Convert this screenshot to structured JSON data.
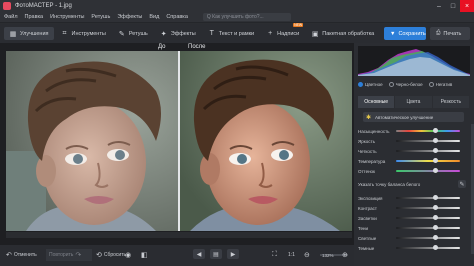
{
  "window": {
    "title": "ФотоМАСТЕР - 1.jpg"
  },
  "menu": {
    "items": [
      "Файл",
      "Правка",
      "Инструменты",
      "Ретушь",
      "Эффекты",
      "Вид",
      "Справка"
    ],
    "search_placeholder": "Q  Как улучшить фото?..."
  },
  "toolbar": {
    "tools": [
      {
        "label": "Улучшения",
        "icon": "enhance-icon",
        "glyph": "▦"
      },
      {
        "label": "Инструменты",
        "icon": "tools-icon",
        "glyph": "⌗"
      },
      {
        "label": "Ретушь",
        "icon": "retouch-icon",
        "glyph": "✎"
      },
      {
        "label": "Эффекты",
        "icon": "effects-icon",
        "glyph": "✦"
      },
      {
        "label": "Текст и рамки",
        "icon": "text-icon",
        "glyph": "T"
      },
      {
        "label": "Надписи",
        "icon": "captions-icon",
        "glyph": "+",
        "badge": "NEW"
      },
      {
        "label": "Пакетная обработка",
        "icon": "batch-icon",
        "glyph": "▣"
      }
    ],
    "save_label": "Сохранить",
    "print_label": "Печать"
  },
  "canvas": {
    "before_label": "До",
    "after_label": "После"
  },
  "panel": {
    "mode_options": [
      "Цветное",
      "Черно-белое",
      "Негатив"
    ],
    "mode_selected": "Цветное",
    "tabs": [
      "Основные",
      "Цвета",
      "Резкость"
    ],
    "auto_label": "Автоматическое улучшение",
    "sliders_top": [
      {
        "label": "Насыщенность",
        "value": 0.62,
        "gradient": "sat"
      },
      {
        "label": "Яркость",
        "value": 0.62,
        "gradient": "gray"
      },
      {
        "label": "Четкость",
        "value": 0.62,
        "gradient": "gray"
      },
      {
        "label": "Температура",
        "value": 0.62,
        "gradient": "temp"
      },
      {
        "label": "Оттенок",
        "value": 0.62,
        "gradient": "tint"
      }
    ],
    "wb_label": "Указать точку баланса белого",
    "sliders_bottom": [
      {
        "label": "Экспозиция",
        "value": 0.62,
        "gradient": "gray"
      },
      {
        "label": "Контраст",
        "value": 0.62,
        "gradient": "gray"
      },
      {
        "label": "Засветки",
        "value": 0.62,
        "gradient": "gray"
      },
      {
        "label": "Тени",
        "value": 0.62,
        "gradient": "gray"
      },
      {
        "label": "Светлые",
        "value": 0.62,
        "gradient": "gray"
      },
      {
        "label": "Темные",
        "value": 0.62,
        "gradient": "gray"
      }
    ]
  },
  "bottom": {
    "undo_label": "Отменить",
    "redo_label": "Повторить",
    "reset_label": "Сбросить",
    "ratio_label": "1:1",
    "zoom_label": "132%"
  },
  "colors": {
    "accent": "#2d7fd9",
    "badge": "#e87a1f"
  }
}
